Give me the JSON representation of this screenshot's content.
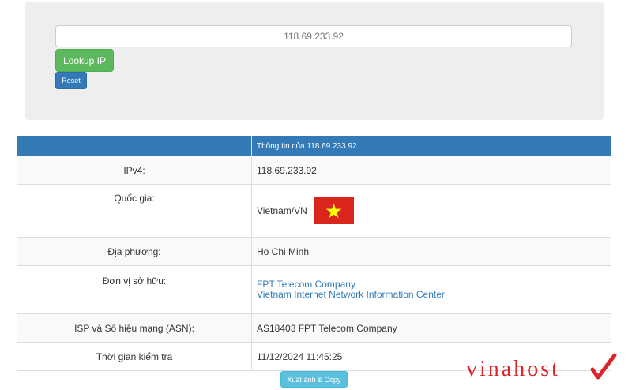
{
  "search": {
    "ip_value": "118.69.233.92",
    "lookup_label": "Lookup IP",
    "reset_label": "Reset"
  },
  "table": {
    "header_left": "",
    "header_right": "Thông tin của 118.69.233.92",
    "rows": [
      {
        "label": "IPv4:",
        "value": "118.69.233.92"
      },
      {
        "label": "Quốc gia:",
        "value": "Vietnam/VN"
      },
      {
        "label": "Địa phương:",
        "value": "Ho Chi Minh"
      },
      {
        "label": "Đơn vị sở hữu:",
        "values": [
          "FPT Telecom Company",
          "Vietnam Internet Network Information Center"
        ]
      },
      {
        "label": "ISP và Số hiệu mạng (ASN):",
        "value": "AS18403 FPT Telecom Company"
      },
      {
        "label": "Thời gian kiểm tra",
        "value": "11/12/2024 11:45:25"
      }
    ]
  },
  "flag": {
    "icon": "vietnam-flag-icon",
    "background": "#da251d",
    "star": "#ffff00"
  },
  "actions": {
    "copy_label": "Xuất ảnh & Copy"
  },
  "logo": {
    "text": "vinahost",
    "color": "#d9262c"
  },
  "colors": {
    "primary": "#337ab7",
    "success": "#5cb85c",
    "info": "#5bc0de",
    "panel": "#eeeeee",
    "link": "#337ab7"
  }
}
